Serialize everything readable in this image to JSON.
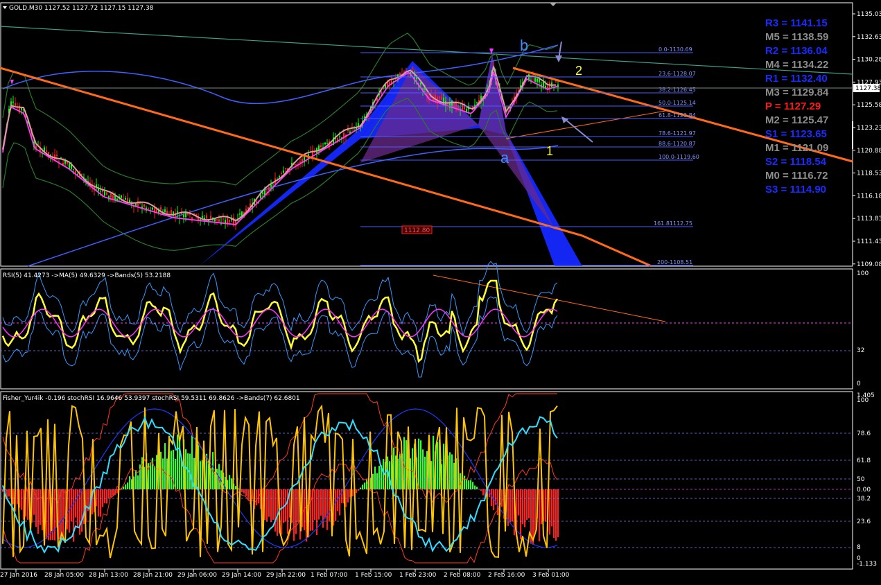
{
  "main": {
    "header": "GOLD,M30  1127.52 1127.72 1127.15 1127.38",
    "price_ticks": [
      "1135.03",
      "1132.63",
      "1130.28",
      "1127.93",
      "1125.58",
      "1123.23",
      "1120.88",
      "1118.53",
      "1116.18",
      "1113.83",
      "1111.43",
      "1109.08"
    ],
    "current_price": "1127.38",
    "pivots": [
      {
        "text": "R3 = 1141.15",
        "color": "#1a2bff"
      },
      {
        "text": "M5 = 1138.59",
        "color": "#8c8c8c"
      },
      {
        "text": "R2 = 1136.04",
        "color": "#1a2bff"
      },
      {
        "text": "M4 = 1134.22",
        "color": "#8c8c8c"
      },
      {
        "text": "R1 = 1132.40",
        "color": "#1a2bff"
      },
      {
        "text": "M3 = 1129.84",
        "color": "#8c8c8c"
      },
      {
        "text": "P  = 1127.29",
        "color": "#ff1a1a"
      },
      {
        "text": "M2 = 1125.47",
        "color": "#8c8c8c"
      },
      {
        "text": "S1 = 1123.65",
        "color": "#1a2bff"
      },
      {
        "text": "M1 = 1121.09",
        "color": "#8c8c8c"
      },
      {
        "text": "S2 = 1118.54",
        "color": "#1a2bff"
      },
      {
        "text": "M0 = 1116.72",
        "color": "#8c8c8c"
      },
      {
        "text": "S3 = 1114.90",
        "color": "#1a2bff"
      }
    ],
    "fib_levels": [
      "0.0-1130.69",
      "23.6-1128.07",
      "38.2-1126.45",
      "50.0-1125.14",
      "61.8-1123.84",
      "78.6-1121.97",
      "88.6-1120.87",
      "100.0-1119.60",
      "161.81112.75",
      "200-1108.51"
    ],
    "price_box": "1112.80",
    "wave_labels": {
      "a": "a",
      "b": "b",
      "one": "1",
      "two": "2"
    }
  },
  "rsi": {
    "header": "RSI(5) 41.4273  ->MA(5) 49.6329  ->Bands(5) 53.2188",
    "ticks": [
      "100",
      "32",
      "0"
    ]
  },
  "fisher": {
    "header": "Fisher_Yur4ik -0.196  stochRSI 16.9646 53.9397  stochRSI 59.5311 69.8626  ->Bands(7) 62.6801",
    "ticks": [
      "1.405",
      "100",
      "78.6",
      "61.8",
      "50",
      "0.00",
      "38.2",
      "23.6",
      "8",
      "0",
      "-1.133"
    ]
  },
  "time_axis": [
    "27 Jan 2016",
    "28 Jan 05:00",
    "28 Jan 13:00",
    "28 Jan 21:00",
    "29 Jan 06:00",
    "29 Jan 14:00",
    "29 Jan 22:00",
    "1 Feb 07:00",
    "1 Feb 15:00",
    "1 Feb 23:00",
    "2 Feb 08:00",
    "2 Feb 16:00",
    "3 Feb 01:00"
  ],
  "colors": {
    "background": "#000000",
    "axis": "#ffffff",
    "candle_up": "#00ff00",
    "candle_down": "#ff2020",
    "trend_orange": "#ff6a1a",
    "harmonic_blue": "#1428ff",
    "harmonic_purple": "#6a2a8a",
    "bollinger": "#2a7a2a",
    "ma_blue": "#4060ff",
    "rsi_yellow": "#ffff33",
    "fisher_green": "#33ff33",
    "fisher_red": "#ff2020"
  }
}
